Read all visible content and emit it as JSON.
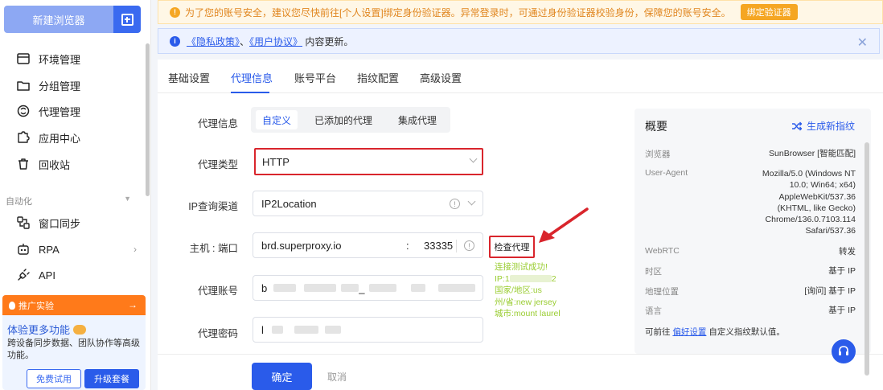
{
  "sidebar": {
    "new_browser": "新建浏览器",
    "items": [
      {
        "label": "环境管理",
        "icon": "window-icon"
      },
      {
        "label": "分组管理",
        "icon": "folder-icon"
      },
      {
        "label": "代理管理",
        "icon": "proxy-icon"
      },
      {
        "label": "应用中心",
        "icon": "puzzle-icon"
      },
      {
        "label": "回收站",
        "icon": "trash-icon"
      }
    ],
    "section_automation": "自动化",
    "auto_items": [
      {
        "label": "窗口同步",
        "icon": "sync-icon"
      },
      {
        "label": "RPA",
        "icon": "robot-icon"
      },
      {
        "label": "API",
        "icon": "plug-icon"
      }
    ],
    "promo": {
      "bar_label": "推广实验",
      "title": "体验更多功能",
      "desc": "跨设备同步数据、团队协作等高级功能。",
      "trial_btn": "免费试用",
      "upgrade_btn": "升级套餐"
    }
  },
  "banners": {
    "warning_text": "为了您的账号安全，建议您尽快前往[个人设置]绑定身份验证器。异常登录时，可通过身份验证器校验身份，保障您的账号安全。",
    "warning_button": "绑定验证器",
    "info_link1": "《隐私政策》",
    "info_sep": "、",
    "info_link2": "《用户协议》",
    "info_suffix": "内容更新。"
  },
  "tabs": [
    "基础设置",
    "代理信息",
    "账号平台",
    "指纹配置",
    "高级设置"
  ],
  "form": {
    "proxy_info_label": "代理信息",
    "proxy_modes": [
      "自定义",
      "已添加的代理",
      "集成代理"
    ],
    "proxy_type_label": "代理类型",
    "proxy_type_value": "HTTP",
    "ip_channel_label": "IP查询渠道",
    "ip_channel_value": "IP2Location",
    "host_port_label": "主机 : 端口",
    "host_value": "brd.superproxy.io",
    "port_sep": ":",
    "port_value": "33335",
    "check_button": "检查代理",
    "result_lines": [
      "连接测试成功!",
      "IP:1",
      "2",
      "国家/地区:us",
      "州/省:new jersey",
      "城市:mount laurel"
    ],
    "account_label": "代理账号",
    "account_visible": "b",
    "account_mid": "_",
    "password_label": "代理密码",
    "password_visible": "l",
    "confirm": "确定",
    "cancel": "取消"
  },
  "summary": {
    "title": "概要",
    "regen": "生成新指纹",
    "rows": [
      {
        "k": "浏览器",
        "v": "SunBrowser [智能匹配]"
      },
      {
        "k": "User-Agent",
        "v": "Mozilla/5.0 (Windows NT 10.0; Win64; x64) AppleWebKit/537.36 (KHTML, like Gecko) Chrome/136.0.7103.114 Safari/537.36"
      },
      {
        "k": "WebRTC",
        "v": "转发"
      },
      {
        "k": "时区",
        "v": "基于 IP"
      },
      {
        "k": "地理位置",
        "v": "[询问] 基于 IP"
      },
      {
        "k": "语言",
        "v": "基于 IP"
      }
    ],
    "foot_prefix": "可前往",
    "foot_link": "偏好设置",
    "foot_suffix": "自定义指纹默认值。"
  },
  "colors": {
    "accent": "#2a5bea",
    "highlight": "#d9252c",
    "success": "#9acd32",
    "warning": "#f5a623"
  }
}
